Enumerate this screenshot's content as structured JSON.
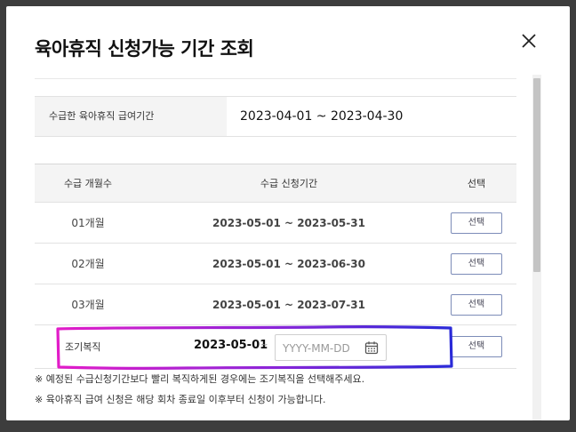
{
  "modal": {
    "title": "육아휴직 신청가능 기간 조회",
    "close_icon": "close-icon"
  },
  "paid_period": {
    "label": "수급한 육아휴직 급여기간",
    "value": "2023-04-01 ~ 2023-04-30"
  },
  "table": {
    "headers": [
      "수급 개월수",
      "수급 신청기간",
      "선택"
    ],
    "rows": [
      {
        "months": "01개월",
        "period": "2023-05-01 ~ 2023-05-31",
        "button": "선택"
      },
      {
        "months": "02개월",
        "period": "2023-05-01 ~ 2023-06-30",
        "button": "선택"
      },
      {
        "months": "03개월",
        "period": "2023-05-01 ~ 2023-07-31",
        "button": "선택"
      }
    ],
    "early_return": {
      "label": "조기복직",
      "start": "2023-05-01",
      "tilde": "~",
      "end_placeholder": "YYYY-MM-DD",
      "end_value": "",
      "button": "선택"
    }
  },
  "notes": [
    "※ 예정된 수급신청기간보다 빨리 복직하게된 경우에는 조기복직을 선택해주세요.",
    "※ 육아휴직 급여 신청은 해당 회차 종료일 이후부터 신청이 가능합니다."
  ],
  "colors": {
    "button_border": "#7c8cb8",
    "highlight_start": "#e21cc8",
    "highlight_end": "#2a2ad8"
  }
}
